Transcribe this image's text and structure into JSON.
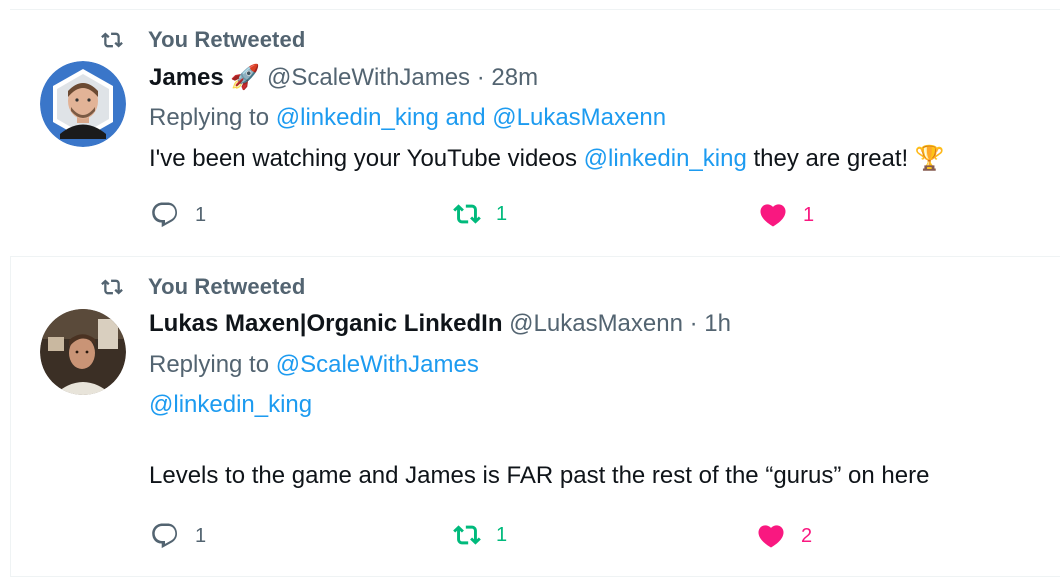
{
  "tweets": [
    {
      "retweet_label": "You Retweeted",
      "avatar": "james-avatar",
      "author_name": "James",
      "author_emoji": "🚀",
      "handle": "@ScaleWithJames",
      "separator": "·",
      "time": "28m",
      "replying_prefix": "Replying to",
      "replying_mentions": [
        "@linkedin_king",
        "@LukasMaxenn"
      ],
      "replying_joiner": "and",
      "body_text_1": "I've been watching your YouTube videos",
      "body_mention": "@linkedin_king",
      "body_text_2": "they are great!",
      "body_emoji": "🏆",
      "reply_count": "1",
      "retweet_count": "1",
      "like_count": "1",
      "retweeted": true,
      "liked": true
    },
    {
      "retweet_label": "You Retweeted",
      "avatar": "lukas-avatar",
      "author_name": "Lukas Maxen|Organic LinkedIn",
      "handle": "@LukasMaxenn",
      "separator": "·",
      "time": "1h",
      "replying_prefix": "Replying to",
      "replying_mentions": [
        "@ScaleWithJames"
      ],
      "body_line_1": "@linkedin_king",
      "body_line_2": "Levels to the game and James is FAR past the rest of the “gurus” on here",
      "reply_count": "1",
      "retweet_count": "1",
      "like_count": "2",
      "retweeted": true,
      "liked": true
    }
  ],
  "colors": {
    "accent_blue": "#1d9bf0",
    "retweet_green": "#00ba7c",
    "like_pink": "#f91880",
    "muted_gray": "#536471",
    "divider": "#eff3f4"
  }
}
